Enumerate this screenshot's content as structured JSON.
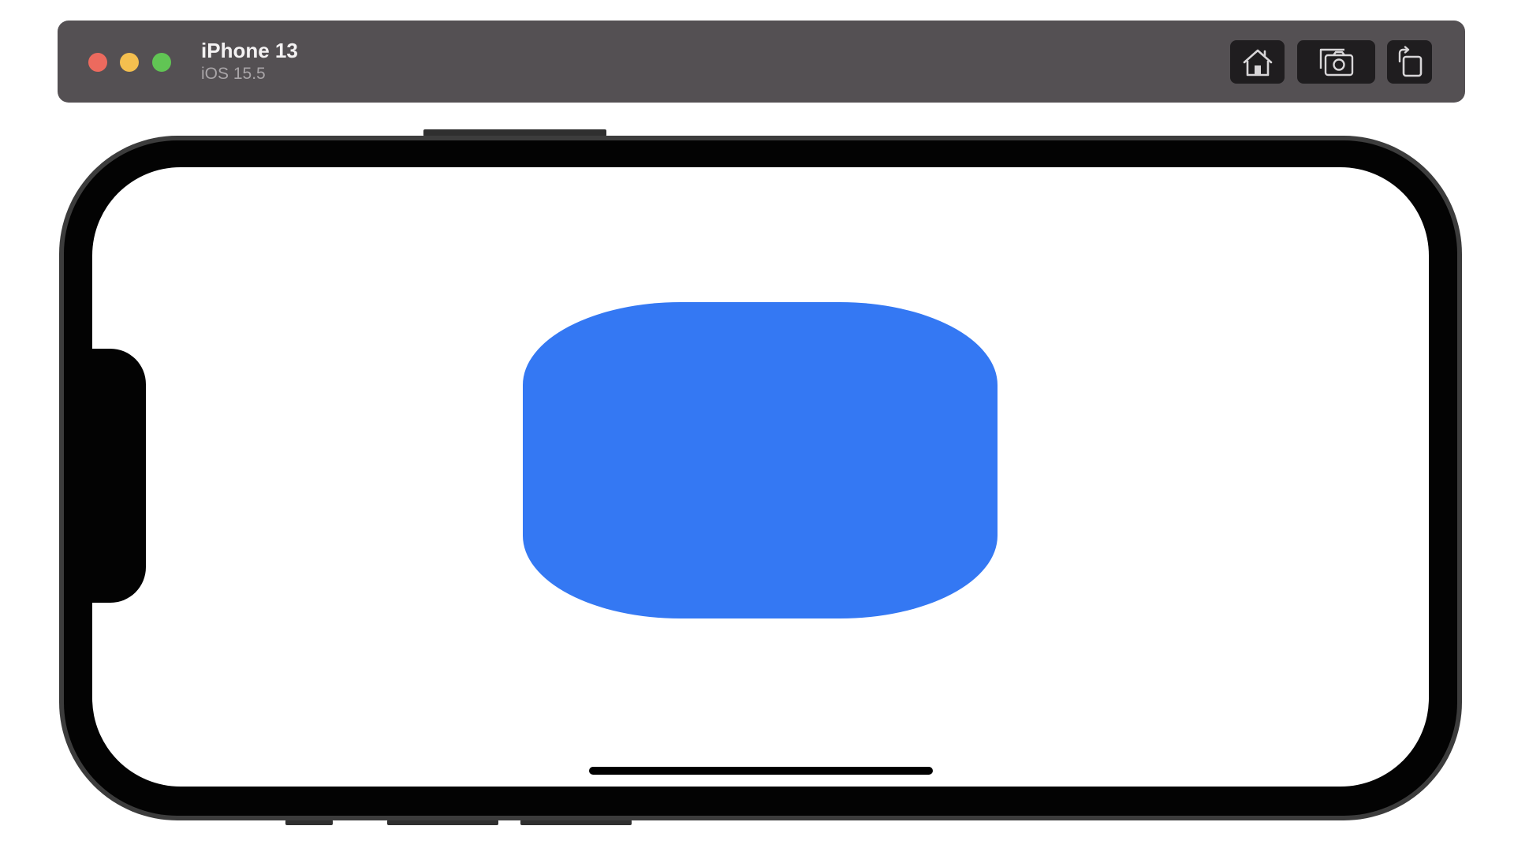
{
  "window": {
    "device_name": "iPhone 13",
    "os_version": "iOS 15.5"
  },
  "toolbar": {
    "buttons": [
      {
        "icon": "home-icon"
      },
      {
        "icon": "screenshot-icon"
      },
      {
        "icon": "rotate-icon"
      }
    ]
  },
  "colors": {
    "titlebar_bg": "#545053",
    "traffic_close": "#ec6a5e",
    "traffic_minimize": "#f4bf4f",
    "traffic_zoom": "#61c554",
    "accent_shape": "#3478f3",
    "screen_bg": "#ffffff"
  }
}
